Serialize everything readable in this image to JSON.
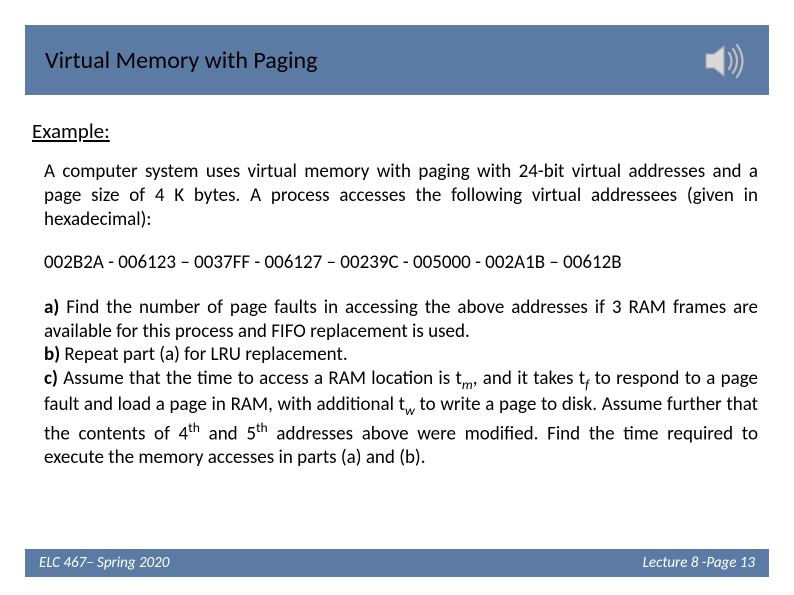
{
  "title": "Virtual Memory with Paging",
  "example_label": "Example:",
  "intro_text": "A computer system uses virtual memory with paging with 24-bit virtual addresses and a page size of 4 K bytes. A process accesses the following virtual addressees (given in hexadecimal):",
  "addresses": "002B2A - 006123 – 0037FF - 006127 – 00239C - 005000 - 002A1B – 00612B",
  "q_a_bold": "a)",
  "q_a_text": " Find the number of page faults in accessing the above addresses if 3 RAM frames are available for this process and FIFO replacement is used.",
  "q_b_bold": "b)",
  "q_b_text": " Repeat part (a) for LRU replacement.",
  "q_c_bold": "c)",
  "q_c_text1": " Assume that the time to access a RAM location is t",
  "q_c_sub1": "m",
  "q_c_text2": ", and it takes t",
  "q_c_sub2": "f",
  "q_c_text3": " to respond to a page fault and load a page in RAM, with additional t",
  "q_c_sub3": "w",
  "q_c_text4": " to write a page to disk.  Assume further that the contents of 4",
  "q_c_sup1": "th",
  "q_c_text5": " and 5",
  "q_c_sup2": "th",
  "q_c_text6": " addresses above were modified.  Find the time required to execute the memory accesses in parts (a) and (b).",
  "footer_left": "ELC 467– Spring 2020",
  "footer_right": "Lecture 8 -Page 13",
  "colors": {
    "bar": "#5b7ba5"
  }
}
